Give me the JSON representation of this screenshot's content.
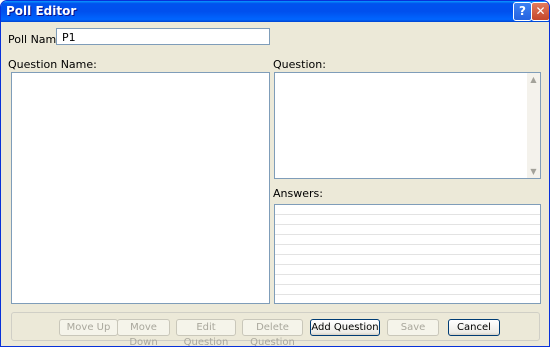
{
  "window": {
    "title": "Poll Editor",
    "help_glyph": "?",
    "close_glyph": "✕"
  },
  "form": {
    "poll_name_label": "Poll Name:",
    "poll_name_value": "P1",
    "question_name_label": "Question Name:",
    "question_label": "Question:",
    "answers_label": "Answers:"
  },
  "buttons": {
    "move_up": "Move Up",
    "move_down": "Move Down",
    "edit_question": "Edit Question",
    "delete_question": "Delete Question",
    "add_question": "Add Question",
    "save": "Save",
    "cancel": "Cancel"
  },
  "icons": {
    "scroll_up": "▲",
    "scroll_down": "▼"
  },
  "colors": {
    "titlebar": "#0054e3",
    "dialog_bg": "#ece9d8",
    "field_border": "#7f9db9"
  }
}
